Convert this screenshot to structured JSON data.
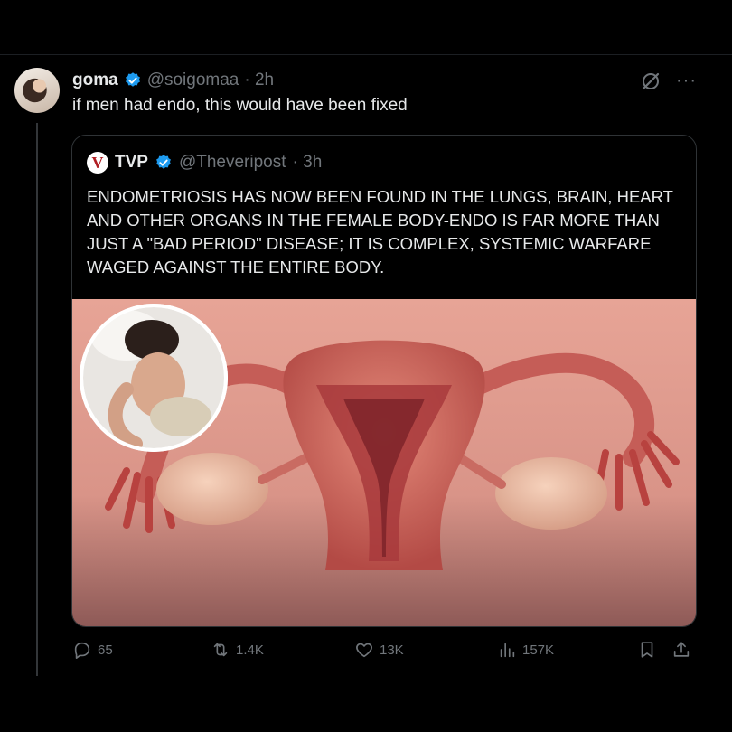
{
  "post": {
    "display_name": "goma",
    "handle": "@soigomaa",
    "time": "· 2h",
    "text": "if men had endo, this would have been fixed",
    "more_label": "···"
  },
  "quote": {
    "logo_letter": "V",
    "display_name": "TVP",
    "handle": "@Theveripost",
    "time": "· 3h",
    "text": "ENDOMETRIOSIS HAS NOW BEEN FOUND IN THE LUNGS, BRAIN, HEART AND OTHER ORGANS IN THE FEMALE BODY-ENDO IS FAR MORE THAN JUST A \"BAD PERIOD\" DISEASE; IT IS COMPLEX, SYSTEMIC WARFARE WAGED AGAINST THE ENTIRE BODY."
  },
  "actions": {
    "replies": "65",
    "reposts": "1.4K",
    "likes": "13K",
    "views": "157K"
  },
  "icons": [
    "verified-icon",
    "grok-icon",
    "more-icon",
    "reply-icon",
    "repost-icon",
    "like-icon",
    "views-icon",
    "bookmark-icon",
    "share-icon"
  ],
  "colors": {
    "verified": "#1d9bf0",
    "muted": "#71767b",
    "text": "#e7e9ea",
    "border": "#2f3336"
  }
}
